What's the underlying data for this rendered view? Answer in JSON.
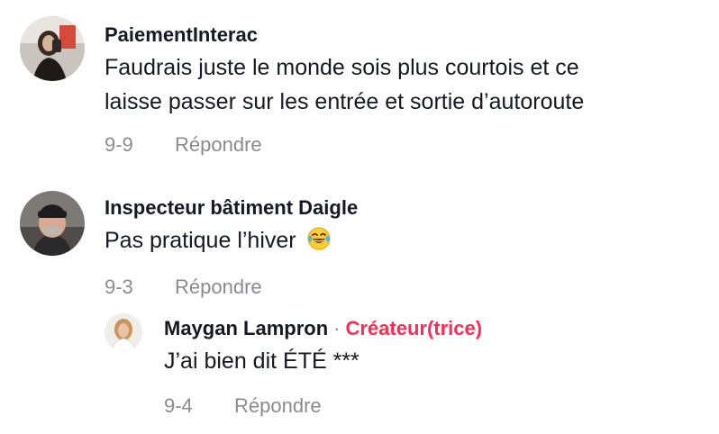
{
  "comments": [
    {
      "username": "PaiementInterac",
      "text_line1": "Faudrais juste le monde sois plus courtois et ce",
      "text_line2": "laisse passer sur les entrée et sortie d’autoroute",
      "date": "9-9",
      "reply_label": "Répondre"
    },
    {
      "username": "Inspecteur bâtiment Daigle",
      "text": "Pas pratique l’hiver",
      "emoji": "face-with-tears-of-joy-icon",
      "date": "9-3",
      "reply_label": "Répondre"
    }
  ],
  "reply": {
    "username": "Maygan Lampron",
    "separator": "·",
    "creator_badge": "Créateur(trice)",
    "text": "J’ai bien dit ÉTÉ ***",
    "date": "9-4",
    "reply_label": "Répondre"
  },
  "colors": {
    "text": "#161823",
    "meta": "#8a8b91",
    "creator": "#fe2c55"
  }
}
